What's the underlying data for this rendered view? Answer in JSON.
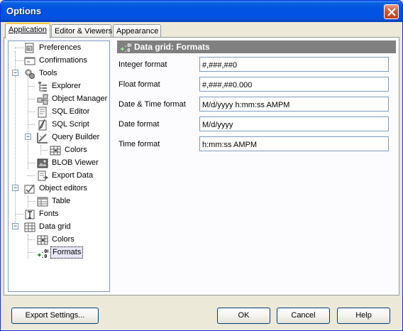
{
  "window": {
    "title": "Options"
  },
  "tabs": [
    {
      "label": "Application",
      "active": true
    },
    {
      "label": "Editor & Viewers",
      "active": false
    },
    {
      "label": "Appearance",
      "active": false
    }
  ],
  "tree": {
    "items": [
      {
        "label": "Preferences",
        "icon": "preferences-icon"
      },
      {
        "label": "Confirmations",
        "icon": "confirmations-icon"
      },
      {
        "label": "Tools",
        "icon": "tools-icon",
        "expanded": true
      },
      {
        "label": "Explorer",
        "icon": "explorer-icon"
      },
      {
        "label": "Object Manager",
        "icon": "object-manager-icon"
      },
      {
        "label": "SQL Editor",
        "icon": "sql-editor-icon"
      },
      {
        "label": "SQL Script",
        "icon": "sql-script-icon"
      },
      {
        "label": "Query Builder",
        "icon": "query-builder-icon",
        "expanded": true
      },
      {
        "label": "Colors",
        "icon": "grid-colors-icon"
      },
      {
        "label": "BLOB Viewer",
        "icon": "blob-viewer-icon"
      },
      {
        "label": "Export Data",
        "icon": "export-data-icon"
      },
      {
        "label": "Object editors",
        "icon": "object-editors-icon",
        "expanded": true
      },
      {
        "label": "Table",
        "icon": "table-icon"
      },
      {
        "label": "Fonts",
        "icon": "fonts-icon"
      },
      {
        "label": "Data grid",
        "icon": "data-grid-icon",
        "expanded": true
      },
      {
        "label": "Colors",
        "icon": "colors-icon"
      },
      {
        "label": "Formats",
        "icon": "formats-icon",
        "selected": true
      }
    ]
  },
  "section": {
    "title": "Data grid: Formats",
    "icon": "formats-icon"
  },
  "fields": [
    {
      "label": "Integer format",
      "value": "#,###,##0"
    },
    {
      "label": "Float format",
      "value": "#,###,##0.000"
    },
    {
      "label": "Date & Time format",
      "value": "M/d/yyyy h:mm:ss AMPM"
    },
    {
      "label": "Date format",
      "value": "M/d/yyyy"
    },
    {
      "label": "Time format",
      "value": "h:mm:ss AMPM"
    }
  ],
  "buttons": {
    "export_settings": "Export Settings...",
    "ok": "OK",
    "cancel": "Cancel",
    "help": "Help"
  },
  "colors": {
    "titlebar": "#0053e0",
    "section_header": "#808080",
    "active_tab_accent": "#ffc83c",
    "close_button": "#c2401e"
  }
}
